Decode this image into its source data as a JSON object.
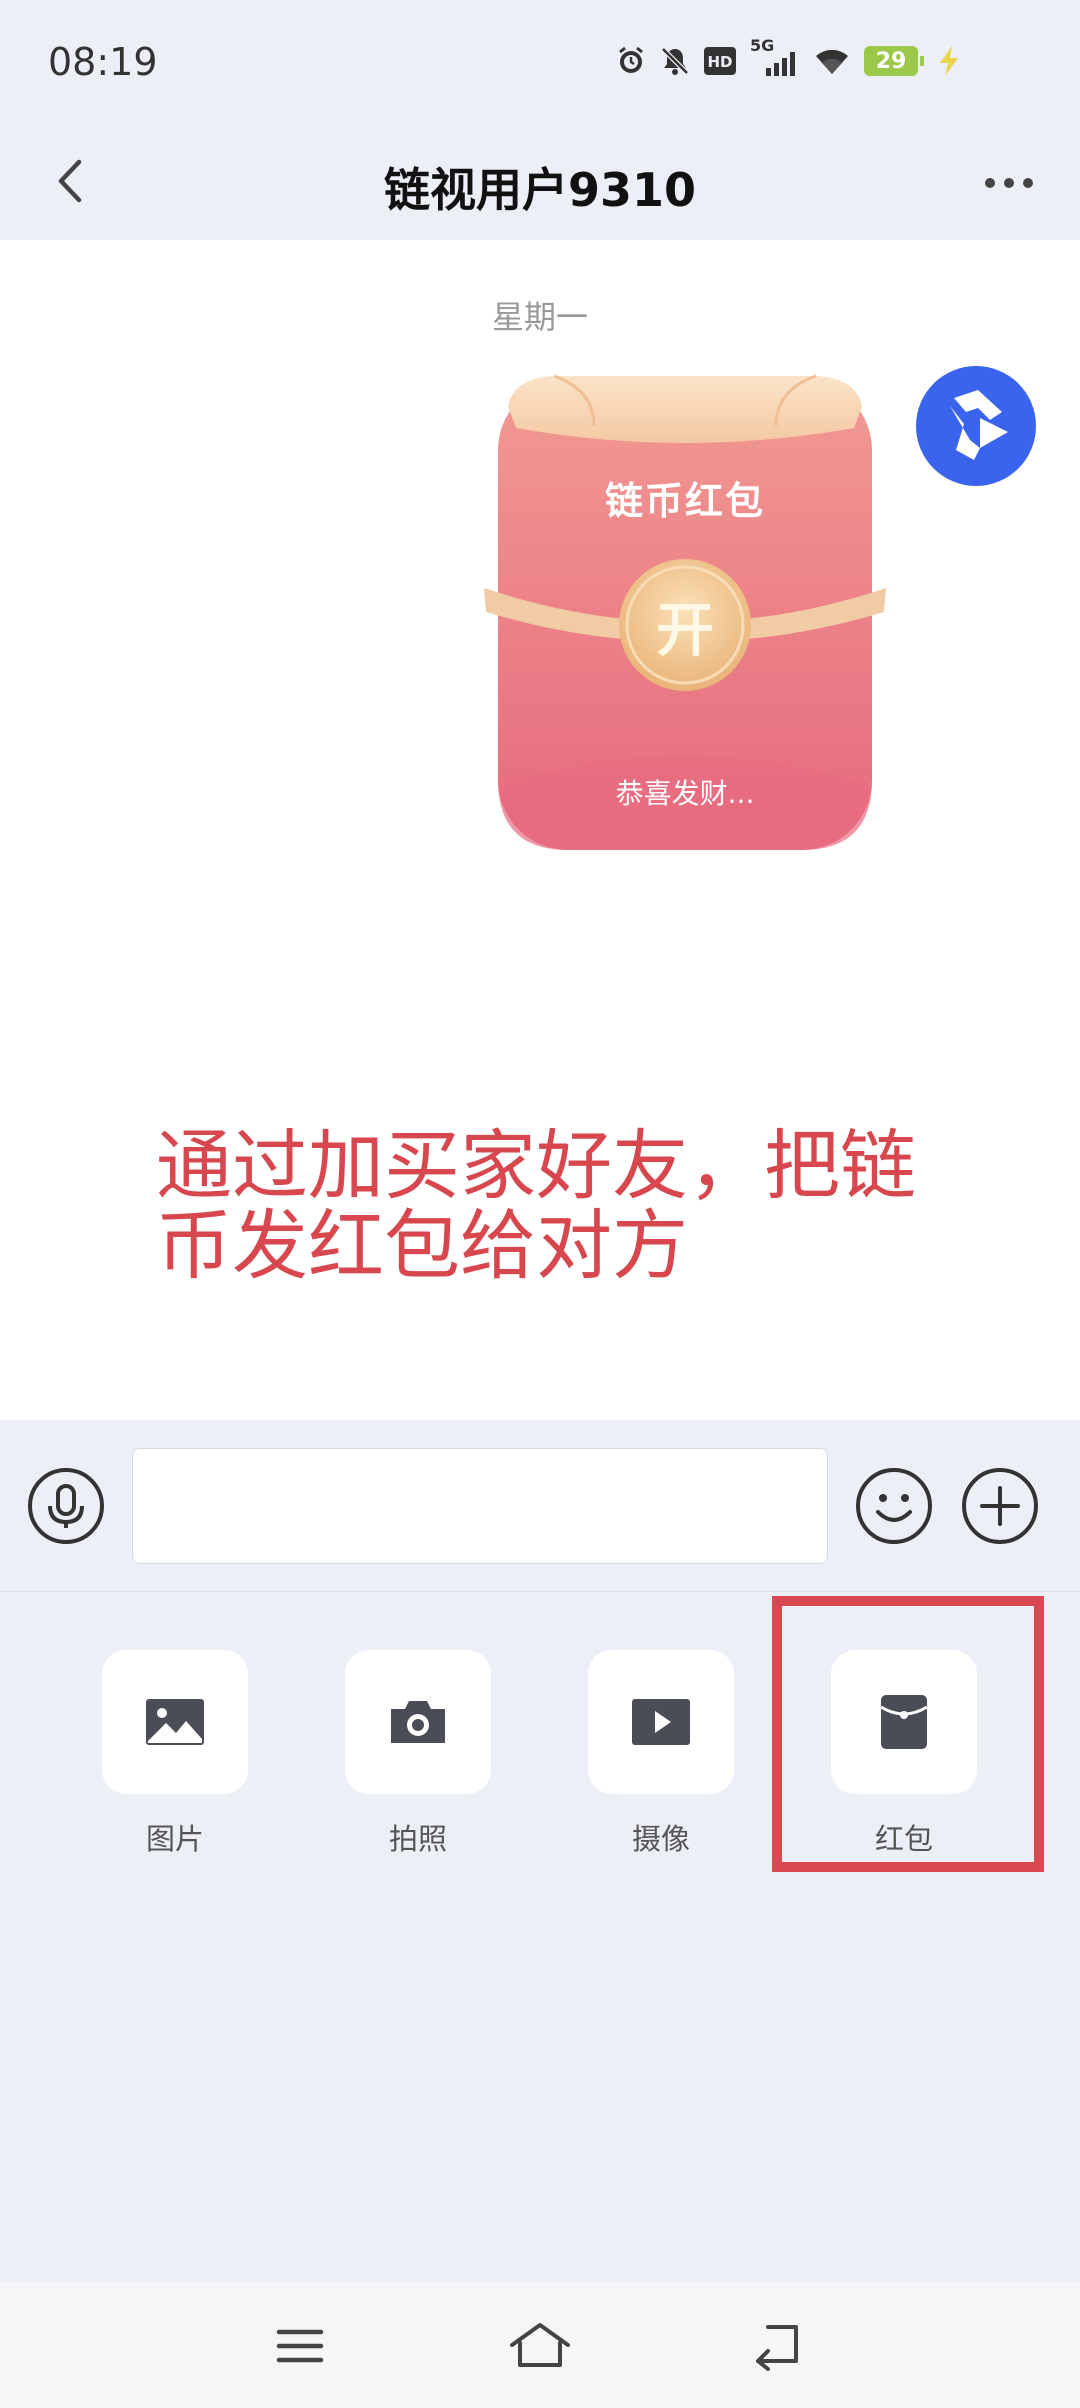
{
  "status_bar": {
    "time": "08:19",
    "network": "5G",
    "hd_label": "HD",
    "battery": "29",
    "icons": [
      "alarm-icon",
      "mute-icon",
      "hd-icon",
      "signal-5g-icon",
      "wifi-icon",
      "battery-icon",
      "charging-icon"
    ]
  },
  "header": {
    "back_icon": "chevron-left-icon",
    "title": "链视用户9310",
    "more_icon": "more-dots-icon"
  },
  "chat": {
    "date_separator": "星期一",
    "red_packet": {
      "title": "链币红包",
      "open_label": "开",
      "greeting": "恭喜发财..."
    },
    "annotation": "通过加买家好友，把链币发红包给对方"
  },
  "input_bar": {
    "voice_icon": "microphone-icon",
    "message_value": "",
    "emoji_icon": "smiley-icon",
    "plus_icon": "plus-icon"
  },
  "tools": [
    {
      "label": "图片",
      "icon": "image-icon"
    },
    {
      "label": "拍照",
      "icon": "camera-icon"
    },
    {
      "label": "摄像",
      "icon": "video-icon"
    },
    {
      "label": "红包",
      "icon": "red-envelope-icon"
    }
  ],
  "nav_bar": {
    "icons": [
      "menu-icon",
      "home-icon",
      "back-icon"
    ]
  },
  "colors": {
    "accent": "#3a64ee",
    "annotation": "#d8464e",
    "highlight_border": "#d94750",
    "battery": "#9cc84a",
    "red_packet": "#ee7b86"
  }
}
